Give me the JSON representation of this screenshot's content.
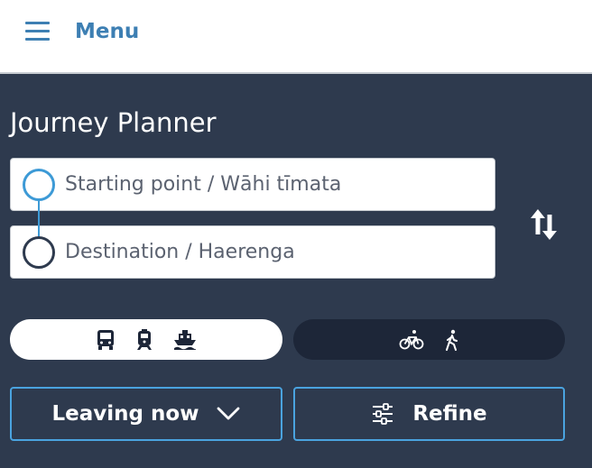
{
  "header": {
    "menu_label": "Menu"
  },
  "planner": {
    "title": "Journey Planner",
    "start_placeholder": "Starting point / Wāhi tīmata",
    "destination_placeholder": "Destination / Haerenga"
  },
  "modes": {
    "transit_icons": [
      "bus-icon",
      "train-icon",
      "ferry-icon"
    ],
    "active_icons": [
      "bicycle-icon",
      "walking-icon"
    ]
  },
  "actions": {
    "leaving_label": "Leaving now",
    "refine_label": "Refine"
  },
  "colors": {
    "background": "#2e3a4e",
    "accent": "#3d7fb3",
    "border_accent": "#4aa3df",
    "active_pill": "#1d2638"
  }
}
